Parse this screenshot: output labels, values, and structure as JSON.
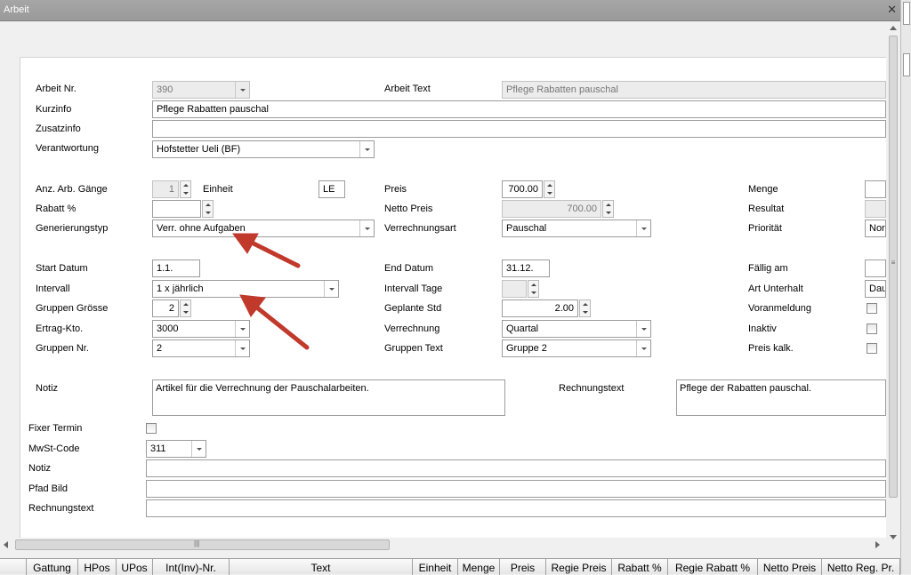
{
  "window": {
    "title": "Arbeit",
    "close_glyph": "✕"
  },
  "form": {
    "arbeit_nr": {
      "label": "Arbeit Nr.",
      "value": "390"
    },
    "arbeit_text": {
      "label": "Arbeit Text",
      "value": "Pflege Rabatten pauschal"
    },
    "kurzinfo": {
      "label": "Kurzinfo",
      "value": "Pflege Rabatten pauschal"
    },
    "zusatzinfo": {
      "label": "Zusatzinfo",
      "value": ""
    },
    "verantwortung": {
      "label": "Verantwortung",
      "value": "Hofstetter Ueli (BF)"
    },
    "anz_arb_gaenge": {
      "label": "Anz. Arb. Gänge",
      "value": "1"
    },
    "einheit": {
      "label": "Einheit",
      "value": "LE"
    },
    "preis": {
      "label": "Preis",
      "value": "700.00"
    },
    "menge": {
      "label": "Menge",
      "value": ""
    },
    "rabatt": {
      "label": "Rabatt %",
      "value": ""
    },
    "netto_preis": {
      "label": "Netto Preis",
      "value": "700.00"
    },
    "resultat": {
      "label": "Resultat",
      "value": ""
    },
    "generierungstyp": {
      "label": "Generierungstyp",
      "value": "Verr. ohne Aufgaben"
    },
    "verrechnungsart": {
      "label": "Verrechnungsart",
      "value": "Pauschal"
    },
    "prioritaet": {
      "label": "Priorität",
      "value": "Nor"
    },
    "start_datum": {
      "label": "Start Datum",
      "value": "1.1."
    },
    "end_datum": {
      "label": "End Datum",
      "value": "31.12."
    },
    "faellig_am": {
      "label": "Fällig am",
      "value": ""
    },
    "intervall": {
      "label": "Intervall",
      "value": "1 x jährlich"
    },
    "intervall_tage": {
      "label": "Intervall Tage",
      "value": ""
    },
    "art_unterhalt": {
      "label": "Art Unterhalt",
      "value": "Dau"
    },
    "gruppen_groesse": {
      "label": "Gruppen Grösse",
      "value": "2"
    },
    "geplante_std": {
      "label": "Geplante Std",
      "value": "2.00"
    },
    "voranmeldung": {
      "label": "Voranmeldung",
      "checked": false
    },
    "ertrag_kto": {
      "label": "Ertrag-Kto.",
      "value": "3000"
    },
    "verrechnung": {
      "label": "Verrechnung",
      "value": "Quartal"
    },
    "inaktiv": {
      "label": "Inaktiv",
      "checked": false
    },
    "gruppen_nr": {
      "label": "Gruppen Nr.",
      "value": "2"
    },
    "gruppen_text": {
      "label": "Gruppen Text",
      "value": "Gruppe 2"
    },
    "preis_kalk": {
      "label": "Preis kalk.",
      "checked": false
    },
    "notiz": {
      "label": "Notiz",
      "value": "Artikel für die Verrechnung der Pauschalarbeiten."
    },
    "rechnungstext": {
      "label": "Rechnungstext",
      "value": "Pflege der Rabatten pauschal."
    }
  },
  "lower": {
    "fixer_termin": {
      "label": "Fixer Termin",
      "checked": false
    },
    "mwst_code": {
      "label": "MwSt-Code",
      "value": "311"
    },
    "notiz": {
      "label": "Notiz",
      "value": ""
    },
    "pfad_bild": {
      "label": "Pfad Bild",
      "value": ""
    },
    "rechnungstext": {
      "label": "Rechnungstext",
      "value": ""
    }
  },
  "scroll": {
    "grip": "|||",
    "vgrip": "≡"
  },
  "grid_columns": [
    "Gattung",
    "HPos",
    "UPos",
    "Int(Inv)-Nr.",
    "Text",
    "Einheit",
    "Menge",
    "Preis",
    "Regie Preis",
    "Rabatt %",
    "Regie Rabatt %",
    "Netto Preis",
    "Netto Reg. Pr."
  ],
  "annotation_color": "#c0392b"
}
